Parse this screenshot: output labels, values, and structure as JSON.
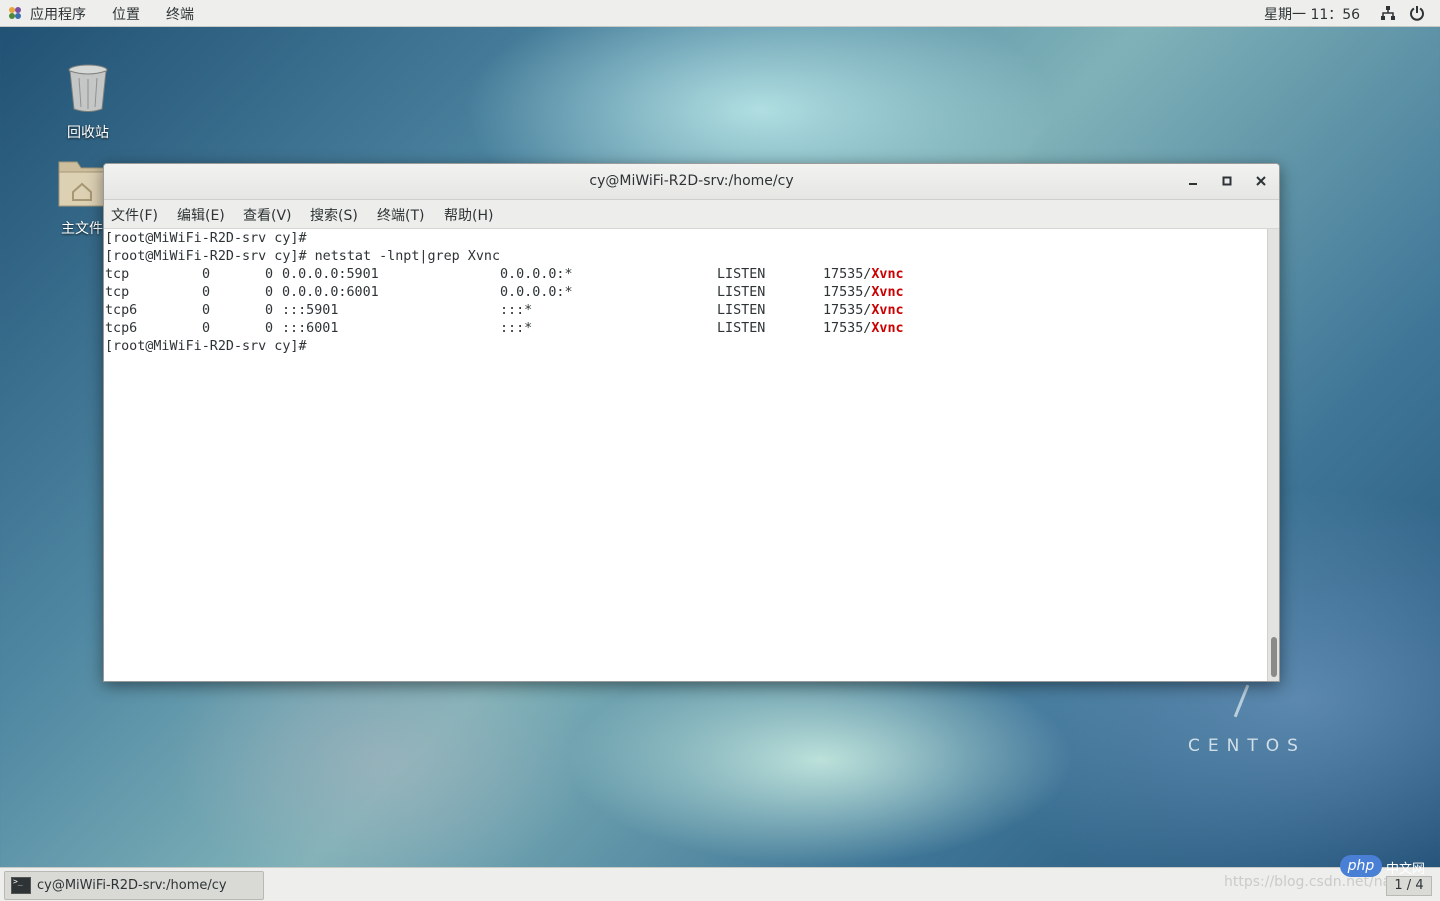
{
  "topbar": {
    "menus": [
      "应用程序",
      "位置",
      "终端"
    ],
    "clock": "星期一 11：56"
  },
  "desktop": {
    "icons": [
      {
        "label": "回收站",
        "icon": "trash-icon"
      },
      {
        "label": "主文件",
        "icon": "home-folder-icon"
      }
    ],
    "watermark": "CENTOS"
  },
  "window": {
    "title": "cy@MiWiFi-R2D-srv:/home/cy",
    "menu": [
      "文件(F)",
      "编辑(E)",
      "查看(V)",
      "搜索(S)",
      "终端(T)",
      "帮助(H)"
    ],
    "terminal": {
      "prompt": "[root@MiWiFi-R2D-srv cy]#",
      "command": " netstat -lnpt|grep Xvnc",
      "rows": [
        {
          "proto": "tcp",
          "recv": "0",
          "send": "0",
          "local": "0.0.0.0:5901",
          "foreign": "0.0.0.0:*",
          "state": "LISTEN",
          "pid": "17535/",
          "prog": "Xvnc"
        },
        {
          "proto": "tcp",
          "recv": "0",
          "send": "0",
          "local": "0.0.0.0:6001",
          "foreign": "0.0.0.0:*",
          "state": "LISTEN",
          "pid": "17535/",
          "prog": "Xvnc"
        },
        {
          "proto": "tcp6",
          "recv": "0",
          "send": "0",
          "local": ":::5901",
          "foreign": ":::*",
          "state": "LISTEN",
          "pid": "17535/",
          "prog": "Xvnc"
        },
        {
          "proto": "tcp6",
          "recv": "0",
          "send": "0",
          "local": ":::6001",
          "foreign": ":::*",
          "state": "LISTEN",
          "pid": "17535/",
          "prog": "Xvnc"
        }
      ]
    }
  },
  "taskbar": {
    "task_label": "cy@MiWiFi-R2D-srv:/home/cy",
    "workspace": "1 / 4",
    "watermark_url": "https://blog.csdn.net/na",
    "php_badge": "php",
    "php_cn": "中文网"
  }
}
